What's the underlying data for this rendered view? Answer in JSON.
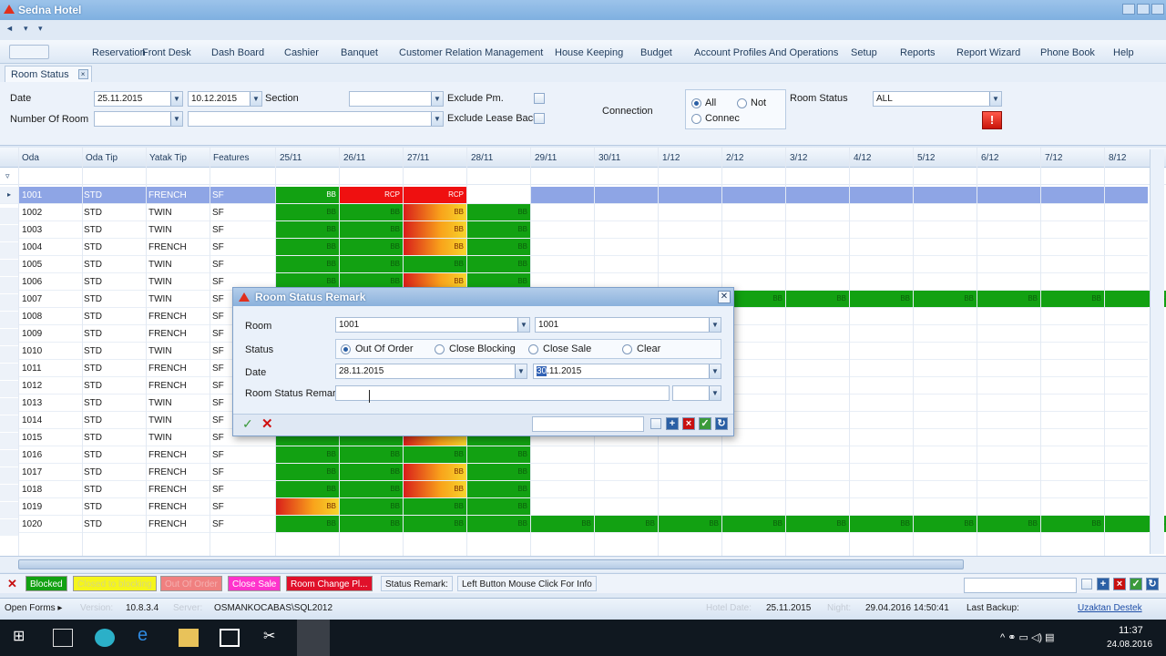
{
  "window": {
    "title": "Sedna Hotel"
  },
  "menu": {
    "items": [
      "Reservation",
      "Front Desk",
      "Dash Board",
      "Cashier",
      "Banquet",
      "Customer Relation Management",
      "House Keeping",
      "Budget",
      "Account Profiles And Operations",
      "Setup",
      "Reports",
      "Report Wizard",
      "Phone Book",
      "Help"
    ]
  },
  "tab": {
    "label": "Room Status",
    "close": "×"
  },
  "filter": {
    "date_label": "Date",
    "date_from": "25.11.2015",
    "date_to": "10.12.2015",
    "section_label": "Section",
    "section_value": "",
    "exclude_pm_label": "Exclude Pm.",
    "exclude_lease_label": "Exclude Lease Back",
    "number_of_room_label": "Number Of Room",
    "number_of_room_value": "",
    "connection_label": "Connection",
    "conn_all": "All",
    "conn_not": "Not",
    "conn_connec": "Connec",
    "room_status_label": "Room Status",
    "room_status_value": "ALL",
    "alert": "!"
  },
  "grid": {
    "headers": [
      "Oda",
      "Oda Tip",
      "Yatak Tip",
      "Features"
    ],
    "dates": [
      "25/11",
      "26/11",
      "27/11",
      "28/11",
      "29/11",
      "30/11",
      "1/12",
      "2/12",
      "3/12",
      "4/12",
      "5/12",
      "6/12",
      "7/12",
      "8/12"
    ],
    "rows": [
      {
        "oda": "1001",
        "tip": "STD",
        "yatak": "FRENCH",
        "feat": "SF",
        "cells": [
          [
            "g",
            "BB"
          ],
          [
            "red",
            "RCP"
          ],
          [
            "red",
            "RCP"
          ],
          [
            "white",
            ""
          ]
        ]
      },
      {
        "oda": "1002",
        "tip": "STD",
        "yatak": "TWIN",
        "feat": "SF",
        "cells": [
          [
            "g",
            "BB"
          ],
          [
            "g",
            "BB"
          ],
          [
            "mix",
            "BB"
          ],
          [
            "g",
            "BB"
          ]
        ]
      },
      {
        "oda": "1003",
        "tip": "STD",
        "yatak": "TWIN",
        "feat": "SF",
        "cells": [
          [
            "g",
            "BB"
          ],
          [
            "g",
            "BB"
          ],
          [
            "mix",
            "BB"
          ],
          [
            "g",
            "BB"
          ]
        ]
      },
      {
        "oda": "1004",
        "tip": "STD",
        "yatak": "FRENCH",
        "feat": "SF",
        "cells": [
          [
            "g",
            "BB"
          ],
          [
            "g",
            "BB"
          ],
          [
            "mix",
            "BB"
          ],
          [
            "g",
            "BB"
          ]
        ]
      },
      {
        "oda": "1005",
        "tip": "STD",
        "yatak": "TWIN",
        "feat": "SF",
        "cells": [
          [
            "g",
            "BB"
          ],
          [
            "g",
            "BB"
          ],
          [
            "g",
            "BB"
          ],
          [
            "g",
            "BB"
          ]
        ]
      },
      {
        "oda": "1006",
        "tip": "STD",
        "yatak": "TWIN",
        "feat": "SF",
        "cells": [
          [
            "g",
            "BB"
          ],
          [
            "g",
            "BB"
          ],
          [
            "mix",
            "BB"
          ],
          [
            "g",
            "BB"
          ]
        ]
      },
      {
        "oda": "1007",
        "tip": "STD",
        "yatak": "TWIN",
        "feat": "SF",
        "cells": [
          [
            "g",
            "BB"
          ],
          [
            "g",
            "BB"
          ],
          [
            "g",
            "BB"
          ],
          [
            "g",
            "BB"
          ],
          [
            "g",
            "BB"
          ],
          [
            "g",
            "BB"
          ],
          [
            "g",
            "BB"
          ],
          [
            "g",
            "BB"
          ],
          [
            "g",
            "BB"
          ],
          [
            "g",
            "BB"
          ],
          [
            "g",
            "BB"
          ],
          [
            "g",
            "BB"
          ],
          [
            "g",
            "BB"
          ],
          [
            "g",
            "BB"
          ]
        ]
      },
      {
        "oda": "1008",
        "tip": "STD",
        "yatak": "FRENCH",
        "feat": "SF",
        "cells": []
      },
      {
        "oda": "1009",
        "tip": "STD",
        "yatak": "FRENCH",
        "feat": "SF",
        "cells": []
      },
      {
        "oda": "1010",
        "tip": "STD",
        "yatak": "TWIN",
        "feat": "SF",
        "cells": []
      },
      {
        "oda": "1011",
        "tip": "STD",
        "yatak": "FRENCH",
        "feat": "SF",
        "cells": []
      },
      {
        "oda": "1012",
        "tip": "STD",
        "yatak": "FRENCH",
        "feat": "SF",
        "cells": []
      },
      {
        "oda": "1013",
        "tip": "STD",
        "yatak": "TWIN",
        "feat": "SF",
        "cells": []
      },
      {
        "oda": "1014",
        "tip": "STD",
        "yatak": "TWIN",
        "feat": "SF",
        "cells": []
      },
      {
        "oda": "1015",
        "tip": "STD",
        "yatak": "TWIN",
        "feat": "SF",
        "cells": [
          [
            "g",
            ""
          ],
          [
            "g",
            ""
          ],
          [
            "mix",
            ""
          ],
          [
            "g",
            ""
          ]
        ]
      },
      {
        "oda": "1016",
        "tip": "STD",
        "yatak": "FRENCH",
        "feat": "SF",
        "cells": [
          [
            "g",
            "BB"
          ],
          [
            "g",
            "BB"
          ],
          [
            "g",
            "BB"
          ],
          [
            "g",
            "BB"
          ]
        ]
      },
      {
        "oda": "1017",
        "tip": "STD",
        "yatak": "FRENCH",
        "feat": "SF",
        "cells": [
          [
            "g",
            "BB"
          ],
          [
            "g",
            "BB"
          ],
          [
            "mix",
            "BB"
          ],
          [
            "g",
            "BB"
          ]
        ]
      },
      {
        "oda": "1018",
        "tip": "STD",
        "yatak": "FRENCH",
        "feat": "SF",
        "cells": [
          [
            "g",
            "BB"
          ],
          [
            "g",
            "BB"
          ],
          [
            "mix",
            "BB"
          ],
          [
            "g",
            "BB"
          ]
        ]
      },
      {
        "oda": "1019",
        "tip": "STD",
        "yatak": "FRENCH",
        "feat": "SF",
        "cells": [
          [
            "mix",
            "BB"
          ],
          [
            "g",
            "BB"
          ],
          [
            "g",
            "BB"
          ],
          [
            "g",
            "BB"
          ]
        ]
      },
      {
        "oda": "1020",
        "tip": "STD",
        "yatak": "FRENCH",
        "feat": "SF",
        "cells": [
          [
            "g",
            "BB"
          ],
          [
            "g",
            "BB"
          ],
          [
            "g",
            "BB"
          ],
          [
            "g",
            "BB"
          ],
          [
            "g",
            "BB"
          ],
          [
            "g",
            "BB"
          ],
          [
            "g",
            "BB"
          ],
          [
            "g",
            "BB"
          ],
          [
            "g",
            "BB"
          ],
          [
            "g",
            "BB"
          ],
          [
            "g",
            "BB"
          ],
          [
            "g",
            "BB"
          ],
          [
            "g",
            "BB"
          ],
          [
            "g",
            "BB"
          ]
        ]
      }
    ]
  },
  "dialog": {
    "title": "Room Status Remark",
    "room_label": "Room",
    "room_from": "1001",
    "room_to": "1001",
    "status_label": "Status",
    "status_options": [
      "Out Of Order",
      "Close Blocking",
      "Close Sale",
      "Clear"
    ],
    "date_label": "Date",
    "date_from": "28.11.2015",
    "date_to_day": "30",
    "date_to_rest": ".11.2015",
    "remark_label": "Room Status Remark",
    "remark_value": ""
  },
  "legend": {
    "items": [
      "Blocked",
      "Closed to blocking",
      "Out Of Order",
      "Close Sale",
      "Room Change Pl..."
    ],
    "status_remark": "Status Remark:",
    "info": "Left Button Mouse Click For Info"
  },
  "statusbar": {
    "open_forms": "Open Forms ▸",
    "version_label": "Version:",
    "version": "10.8.3.4",
    "server_label": "Server:",
    "server": "OSMANKOCABAS\\SQL2012",
    "hotel_date_label": "Hotel Date:",
    "hotel_date": "25.11.2015",
    "night_label": "Night:",
    "night": "29.04.2016 14:50:41",
    "last_backup": "Last Backup:",
    "remote": "Uzaktan Destek"
  },
  "taskbar": {
    "time": "11:37",
    "date": "24.08.2016"
  },
  "colors": {
    "green": "#12a112",
    "red": "#ef1010",
    "selection": "#8ea5e5",
    "yellow": "#f5f51c",
    "pink": "#f08080",
    "magenta": "#ff33cc",
    "crimson": "#e0102a"
  }
}
